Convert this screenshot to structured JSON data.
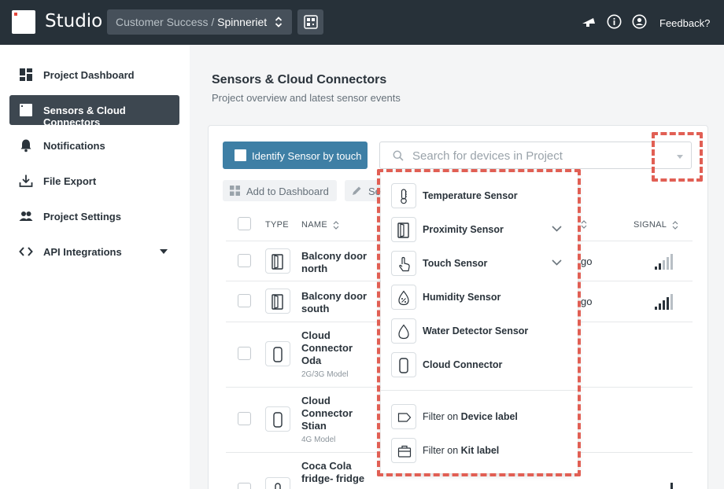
{
  "topbar": {
    "app_name": "Studio",
    "org": "Customer Success",
    "separator": "/",
    "project": "Spinneriet",
    "feedback_label": "Feedback?"
  },
  "sidebar": {
    "items": [
      {
        "label": "Project Dashboard",
        "icon": "dashboard-icon"
      },
      {
        "label": "Sensors & Cloud Connectors",
        "icon": "sensor-icon",
        "active": true
      },
      {
        "label": "Notifications",
        "icon": "bell-icon"
      },
      {
        "label": "File Export",
        "icon": "download-icon"
      },
      {
        "label": "Project Settings",
        "icon": "people-icon"
      },
      {
        "label": "API Integrations",
        "icon": "code-icon"
      }
    ]
  },
  "page": {
    "title": "Sensors & Cloud Connectors",
    "subtitle": "Project overview and latest sensor events"
  },
  "toolbar": {
    "identify_label": "Identify Sensor by touch",
    "search_placeholder": "Search for devices in Project",
    "add_dashboard_label": "Add to Dashboard",
    "second_button_label": "Se"
  },
  "table": {
    "headers": {
      "type": "TYPE",
      "name": "NAME",
      "signal": "SIGNAL"
    },
    "rows": [
      {
        "name": "Balcony door north",
        "model": "",
        "ago": "go",
        "signal_level": 2,
        "type_icon": "door-icon"
      },
      {
        "name": "Balcony door south",
        "model": "",
        "ago": "go",
        "signal_level": 4,
        "type_icon": "door-icon"
      },
      {
        "name": "Cloud Connector Oda",
        "model": "2G/3G Model",
        "ago": "",
        "type_icon": "cloud-connector-icon"
      },
      {
        "name": "Cloud Connector Stian",
        "model": "4G Model",
        "ago": "",
        "type_icon": "cloud-connector-icon"
      },
      {
        "name": "Coca Cola fridge- fridge",
        "model": "",
        "ago": "",
        "type_icon": "temperature-icon"
      }
    ]
  },
  "filter_menu": {
    "items": [
      {
        "label": "Temperature Sensor",
        "icon": "thermometer-icon",
        "expandable": false
      },
      {
        "label": "Proximity Sensor",
        "icon": "door-icon",
        "expandable": true
      },
      {
        "label": "Touch Sensor",
        "icon": "touch-icon",
        "expandable": true
      },
      {
        "label": "Humidity Sensor",
        "icon": "humidity-icon",
        "expandable": false
      },
      {
        "label": "Water Detector Sensor",
        "icon": "water-drop-icon",
        "expandable": false
      },
      {
        "label": "Cloud Connector",
        "icon": "cloud-connector-icon",
        "expandable": false
      }
    ],
    "label_filters": [
      {
        "prefix": "Filter on",
        "label": "Device label",
        "icon": "tag-icon"
      },
      {
        "prefix": "Filter on",
        "label": "Kit label",
        "icon": "briefcase-icon"
      }
    ]
  },
  "colors": {
    "topbar": "#273139",
    "accent": "#3e7fa5",
    "highlight": "#e15f54",
    "active_nav": "#3d4750"
  }
}
